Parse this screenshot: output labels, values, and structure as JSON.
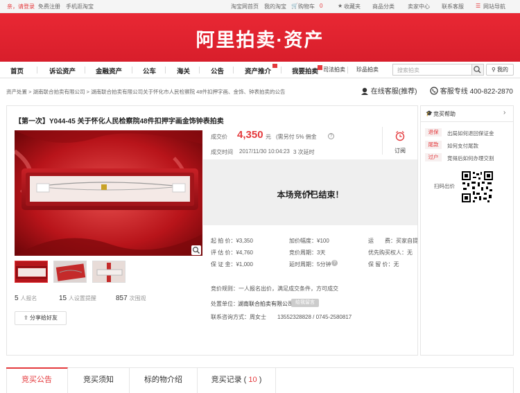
{
  "topbar": {
    "greeting": "亲，请登录",
    "register": "免费注册",
    "mobile": "手机逛淘宝",
    "home": "淘宝网首页",
    "my_taobao": "我的淘宝",
    "cart": "购物车",
    "cart_count": "0",
    "favorites": "收藏夹",
    "categories": "商品分类",
    "seller": "卖家中心",
    "support": "联系客服",
    "sitemap": "网站导航"
  },
  "banner": {
    "title": "阿里拍卖·资产"
  },
  "nav": {
    "items": [
      "首页",
      "诉讼资产",
      "金融资产",
      "公车",
      "海关",
      "公告",
      "资产推介",
      "我要拍卖",
      "司法拍卖",
      "珍品拍卖"
    ],
    "search_placeholder": "搜索拍卖",
    "my_label": "我的"
  },
  "breadcrumb": "资产处置 > 湖南联合拍卖有限公司 > 湖南联合拍卖有限公司关于怀化市人民检察院 48件扣押字画、金饰、钟表拍卖的公告",
  "service": {
    "online": "在线客服(推荐)",
    "hotline_label": "客服专线",
    "hotline": "400-822-2870"
  },
  "item": {
    "title": "【第一次】Y044-45 关于怀化人民检察院48件扣押字画金饰钟表拍卖",
    "stats": {
      "signups": "5",
      "signups_label": "人报名",
      "reminders": "15",
      "reminders_label": "人设置提醒",
      "views": "857",
      "views_label": "次围观"
    },
    "share": "分享给好友"
  },
  "deal": {
    "price_label": "成交价",
    "price": "4,350",
    "currency": "元",
    "commission": "(需另付 5% 佣金",
    "time_label": "成交时间",
    "time": "2017/11/30 10:04:23",
    "extensions": "3 次延时",
    "reminder": "订阅",
    "ended": "本场竞价已结束！"
  },
  "details": {
    "start_price": "起 拍 价：¥3,350",
    "eval_price": "评 估 价：¥4,760",
    "deposit": "保 证 金：¥1,000",
    "increment": "加价幅度：¥100",
    "period": "竞价周期：3天",
    "delay": "延时周期：5分钟",
    "shipping": "运　　费：买家自提",
    "priority": "优先购买权人：无",
    "reserve": "保 留 价：无",
    "rule": "竞价规则：一人报名出价，满足成交条件，方可成交",
    "unit_label": "处置单位：",
    "unit": "湖南联合拍卖有限公司",
    "unit_tag": "给我留言",
    "contact": "联系咨询方式：周女士　　13552328828 / 0745-2580817"
  },
  "tabs": [
    {
      "label": "竞买公告"
    },
    {
      "label": "竞买须知"
    },
    {
      "label": "标的物介绍"
    },
    {
      "label": "竞买记录",
      "count": "10"
    }
  ],
  "sidebar": {
    "title": "竞买帮助",
    "help": [
      {
        "tag": "退保",
        "text": "出局如何退回保证金"
      },
      {
        "tag": "尾款",
        "text": "如何支付尾款"
      },
      {
        "tag": "过户",
        "text": "竞得后如何办理交割"
      }
    ],
    "qr_label": "扫码出价"
  },
  "colors": {
    "brand": "#e4393c",
    "banner": "#de2230"
  }
}
